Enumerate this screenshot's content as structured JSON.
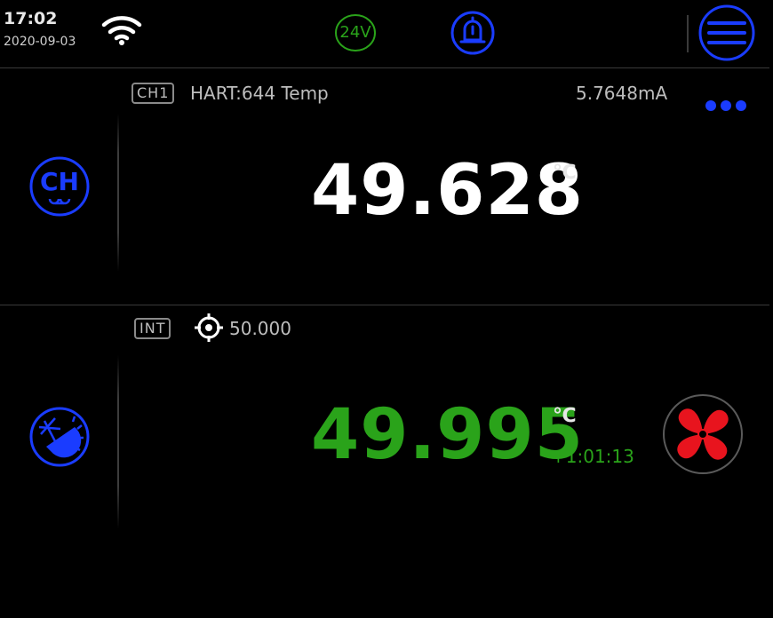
{
  "status": {
    "time": "17:02",
    "date": "2020-09-03",
    "supply_voltage": "24V",
    "icons": [
      "wifi-icon",
      "alarm-bell-icon",
      "menu-icon"
    ]
  },
  "channel1": {
    "tag": "CH1",
    "name": "HART:644 Temp",
    "current": "5.7648mA",
    "value": "49.628",
    "unit": "℃",
    "icons": [
      "channel-icon",
      "more-dots-icon"
    ]
  },
  "internal": {
    "tag": "INT",
    "setpoint": "50.000",
    "value": "49.995",
    "unit": "℃",
    "elapsed": "+1:01:13",
    "icons": [
      "crosshair-icon",
      "heat-cool-mode-icon",
      "fan-icon"
    ]
  },
  "colors": {
    "accent_blue": "#1a3cff",
    "ok_green": "#2aa31a",
    "fan_red": "#e8141e",
    "divider": "#3a3a3a"
  }
}
